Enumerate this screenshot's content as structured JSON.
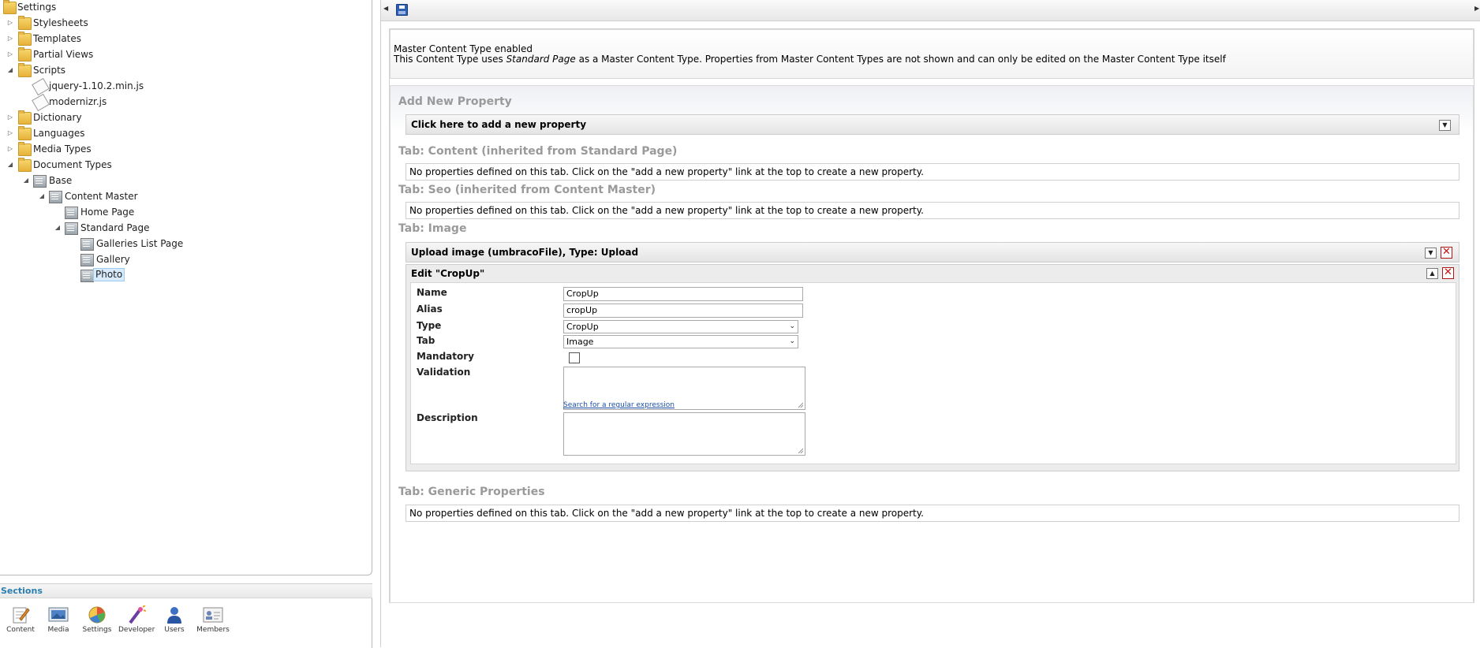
{
  "tree": {
    "root": "Settings",
    "items": [
      {
        "label": "Stylesheets"
      },
      {
        "label": "Templates"
      },
      {
        "label": "Partial Views"
      },
      {
        "label": "Scripts"
      },
      {
        "label": "jquery-1.10.2.min.js"
      },
      {
        "label": "modernizr.js"
      },
      {
        "label": "Dictionary"
      },
      {
        "label": "Languages"
      },
      {
        "label": "Media Types"
      },
      {
        "label": "Document Types"
      },
      {
        "label": "Base"
      },
      {
        "label": "Content Master"
      },
      {
        "label": "Home Page"
      },
      {
        "label": "Standard Page"
      },
      {
        "label": "Galleries List Page"
      },
      {
        "label": "Gallery"
      },
      {
        "label": "Photo"
      }
    ]
  },
  "sections": {
    "title": "Sections",
    "items": [
      {
        "label": "Content"
      },
      {
        "label": "Media"
      },
      {
        "label": "Settings"
      },
      {
        "label": "Developer"
      },
      {
        "label": "Users"
      },
      {
        "label": "Members"
      }
    ]
  },
  "notice": {
    "title": "Master Content Type enabled",
    "text_before": "This Content Type uses ",
    "text_em": "Standard Page",
    "text_after": " as a Master Content Type. Properties from Master Content Types are not shown and can only be edited on the Master Content Type itself"
  },
  "add_property": {
    "heading": "Add New Property",
    "bar_label": "Click here to add a new property"
  },
  "tabs": {
    "content_heading": "Tab: Content (inherited from Standard Page)",
    "seo_heading": "Tab: Seo (inherited from Content Master)",
    "image_heading": "Tab: Image",
    "generic_heading": "Tab: Generic Properties",
    "empty_message": "No properties defined on this tab. Click on the \"add a new property\" link at the top to create a new property."
  },
  "upload_property": {
    "label": "Upload image (umbracoFile), Type: Upload"
  },
  "edit_property": {
    "header": "Edit \"CropUp\"",
    "labels": {
      "name": "Name",
      "alias": "Alias",
      "type": "Type",
      "tab": "Tab",
      "mandatory": "Mandatory",
      "validation": "Validation",
      "description": "Description"
    },
    "values": {
      "name": "CropUp",
      "alias": "cropUp",
      "type": "CropUp",
      "tab": "Image",
      "mandatory": false,
      "validation": "",
      "description": ""
    },
    "regex_link": "Search for a regular expression"
  },
  "colors": {
    "accent_link": "#1a4ea8",
    "sections_title": "#2a7fb0",
    "delete_red": "#c41212",
    "folder_yellow": "#e6b13a"
  }
}
